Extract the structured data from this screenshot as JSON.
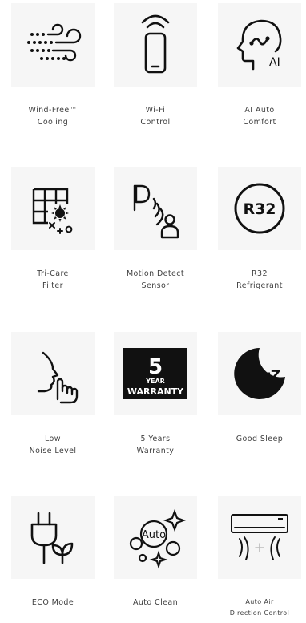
{
  "features": [
    {
      "id": "wind-free",
      "icon": "wind-free-icon",
      "lines": [
        "Wind-Free™",
        "Cooling"
      ]
    },
    {
      "id": "wifi",
      "icon": "wifi-remote-icon",
      "lines": [
        "Wi-Fi",
        "Control"
      ]
    },
    {
      "id": "ai-comfort",
      "icon": "ai-head-icon",
      "icon_text": "AI",
      "lines": [
        "AI Auto",
        "Comfort"
      ]
    },
    {
      "id": "tri-care",
      "icon": "filter-grid-icon",
      "lines": [
        "Tri-Care",
        "Filter"
      ]
    },
    {
      "id": "motion",
      "icon": "motion-sensor-icon",
      "lines": [
        "Motion Detect",
        "Sensor"
      ]
    },
    {
      "id": "r32",
      "icon": "r32-badge-icon",
      "icon_text": "R32",
      "lines": [
        "R32",
        "Refrigerant"
      ]
    },
    {
      "id": "low-noise",
      "icon": "hush-face-icon",
      "lines": [
        "Low",
        "Noise Level"
      ]
    },
    {
      "id": "warranty",
      "icon": "warranty-badge-icon",
      "icon_text": [
        "5",
        "YEAR",
        "WARRANTY"
      ],
      "lines": [
        "5 Years",
        "Warranty"
      ]
    },
    {
      "id": "sleep",
      "icon": "moon-sleep-icon",
      "icon_text": "zZ",
      "lines": [
        "Good Sleep"
      ]
    },
    {
      "id": "eco",
      "icon": "plug-leaf-icon",
      "lines": [
        "ECO Mode"
      ]
    },
    {
      "id": "auto-clean",
      "icon": "sparkle-bubbles-icon",
      "icon_text": "Auto",
      "lines": [
        "Auto Clean"
      ]
    },
    {
      "id": "air-direction",
      "icon": "ac-airflow-icon",
      "lines": [
        "Auto Air",
        "Direction Control"
      ]
    }
  ],
  "colors": {
    "tile_bg": "#f6f6f6",
    "icon": "#111111",
    "text": "#3e3e3e"
  }
}
